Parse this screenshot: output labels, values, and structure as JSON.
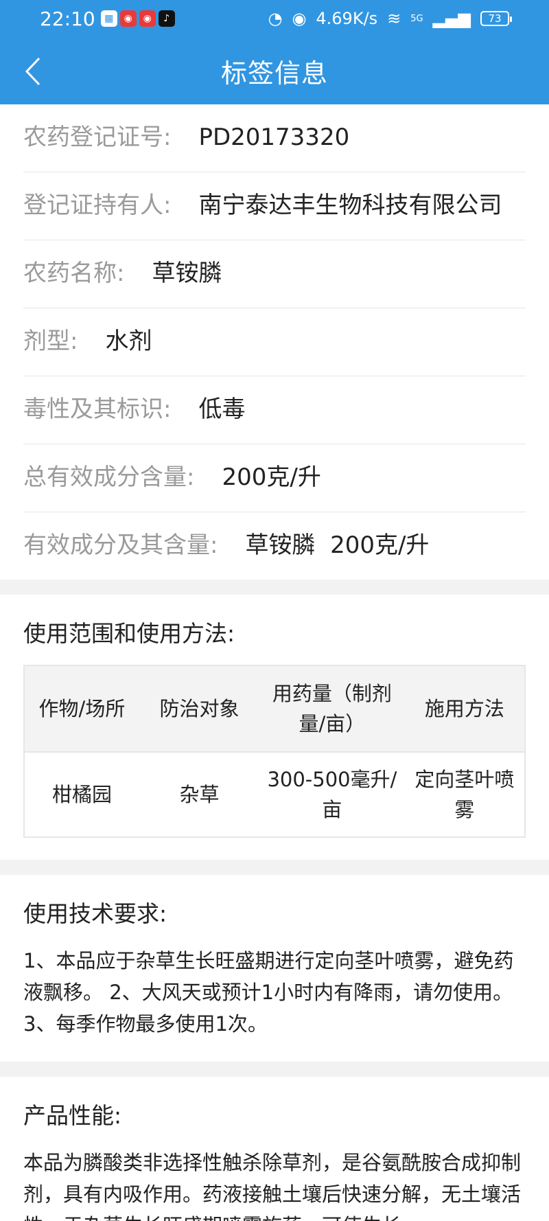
{
  "statusbar": {
    "time": "22:10",
    "net_speed": "4.69K/s",
    "network": "5G",
    "battery": "73"
  },
  "header": {
    "title": "标签信息"
  },
  "info": [
    {
      "label": "农药登记证号:",
      "value": "PD20173320"
    },
    {
      "label": "登记证持有人:",
      "value": "南宁泰达丰生物科技有限公司"
    },
    {
      "label": "农药名称:",
      "value": "草铵膦"
    },
    {
      "label": "剂型:",
      "value": "水剂"
    },
    {
      "label": "毒性及其标识:",
      "value": "低毒"
    },
    {
      "label": "总有效成分含量:",
      "value": "200克/升"
    },
    {
      "label": "有效成分及其含量:",
      "value": "草铵膦  200克/升"
    }
  ],
  "usage": {
    "title": "使用范围和使用方法:",
    "headers": [
      "作物/场所",
      "防治对象",
      "用药量（制剂量/亩）",
      "施用方法"
    ],
    "rows": [
      [
        "柑橘园",
        "杂草",
        "300-500毫升/亩",
        "定向茎叶喷雾"
      ]
    ]
  },
  "tech": {
    "title": "使用技术要求:",
    "text": "1、本品应于杂草生长旺盛期进行定向茎叶喷雾，避免药液飘移。 2、大风天或预计1小时内有降雨，请勿使用。 3、每季作物最多使用1次。"
  },
  "performance": {
    "title": "产品性能:",
    "text": "本品为膦酸类非选择性触杀除草剂，是谷氨酰胺合成抑制剂，具有内吸作用。药液接触土壤后快速分解，无土壤活性。于杂草生长旺盛期喷雾施药，可使生长"
  }
}
